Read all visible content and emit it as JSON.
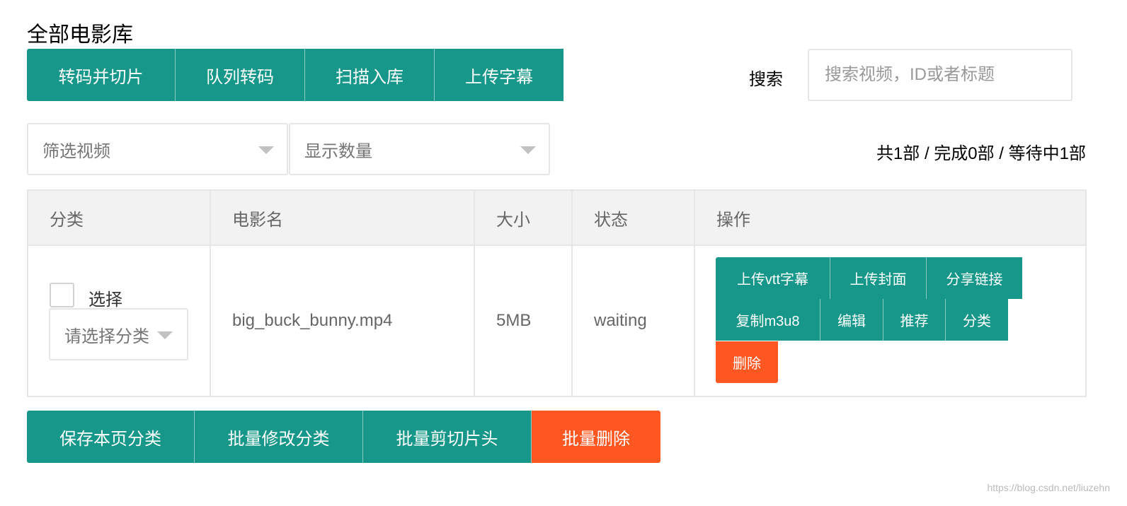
{
  "title": "全部电影库",
  "toolbar": {
    "buttons": [
      "转码并切片",
      "队列转码",
      "扫描入库",
      "上传字幕"
    ]
  },
  "search": {
    "label": "搜索",
    "placeholder": "搜索视频，ID或者标题",
    "value": ""
  },
  "filters": {
    "filter_video": "筛选视频",
    "display_count": "显示数量"
  },
  "stats": "共1部 / 完成0部 / 等待中1部",
  "table": {
    "headers": [
      "分类",
      "电影名",
      "大小",
      "状态",
      "操作"
    ],
    "rows": [
      {
        "select_label": "选择",
        "category_placeholder": "请选择分类",
        "name": "big_buck_bunny.mp4",
        "size": "5MB",
        "status": "waiting",
        "actions": [
          "上传vtt字幕",
          "上传封面",
          "分享链接",
          "复制m3u8",
          "编辑",
          "推荐",
          "分类",
          "删除"
        ]
      }
    ]
  },
  "bottom": {
    "buttons": [
      "保存本页分类",
      "批量修改分类",
      "批量剪切片头",
      "批量删除"
    ]
  },
  "watermark": "https://blog.csdn.net/liuzehn",
  "colors": {
    "primary": "#16978a",
    "danger": "#ff5722"
  }
}
